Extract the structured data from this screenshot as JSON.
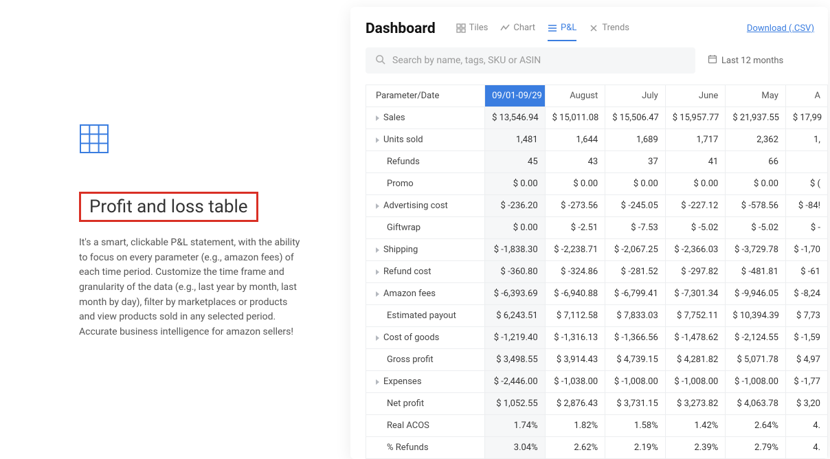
{
  "left": {
    "heading": "Profit and loss table",
    "description": "It's a smart, clickable P&L statement, with the ability to focus on every parameter (e.g., amazon fees) of each time period. Customize the time frame and granularity of the data (e.g., last year by month, last month by day), filter by marketplaces or products and view products sold in any selected period. Accurate business intelligence for amazon sellers!"
  },
  "dashboard": {
    "title": "Dashboard",
    "tabs": {
      "tiles": "Tiles",
      "chart": "Chart",
      "pl": "P&L",
      "trends": "Trends"
    },
    "download": "Download (.CSV)",
    "search_placeholder": "Search by name, tags, SKU or ASIN",
    "date_range": "Last 12 months",
    "param_header": "Parameter/Date",
    "columns": [
      "09/01-09/29",
      "August",
      "July",
      "June",
      "May",
      "A"
    ],
    "rows": [
      {
        "label": "Sales",
        "expandable": true,
        "values": [
          "$ 13,546.94",
          "$ 15,011.08",
          "$ 15,506.47",
          "$ 15,957.77",
          "$ 21,937.55",
          "$ 17,99"
        ]
      },
      {
        "label": "Units sold",
        "expandable": true,
        "values": [
          "1,481",
          "1,644",
          "1,689",
          "1,717",
          "2,362",
          "1,"
        ]
      },
      {
        "label": "Refunds",
        "expandable": false,
        "values": [
          "45",
          "43",
          "37",
          "41",
          "66",
          ""
        ]
      },
      {
        "label": "Promo",
        "expandable": false,
        "values": [
          "$ 0.00",
          "$ 0.00",
          "$ 0.00",
          "$ 0.00",
          "$ 0.00",
          "$ ("
        ]
      },
      {
        "label": "Advertising cost",
        "expandable": true,
        "values": [
          "$ -236.20",
          "$ -273.56",
          "$ -245.05",
          "$ -227.12",
          "$ -578.56",
          "$ -84!"
        ]
      },
      {
        "label": "Giftwrap",
        "expandable": false,
        "values": [
          "$ 0.00",
          "$ -2.51",
          "$ -7.53",
          "$ -5.02",
          "$ -5.02",
          "$ -"
        ]
      },
      {
        "label": "Shipping",
        "expandable": true,
        "values": [
          "$ -1,838.30",
          "$ -2,238.71",
          "$ -2,067.25",
          "$ -2,366.03",
          "$ -3,729.78",
          "$ -1,70"
        ]
      },
      {
        "label": "Refund cost",
        "expandable": true,
        "values": [
          "$ -360.80",
          "$ -324.86",
          "$ -281.52",
          "$ -297.82",
          "$ -481.81",
          "$ -61"
        ]
      },
      {
        "label": "Amazon fees",
        "expandable": true,
        "values": [
          "$ -6,393.69",
          "$ -6,940.88",
          "$ -6,799.41",
          "$ -7,301.34",
          "$ -9,946.05",
          "$ -8,24"
        ]
      },
      {
        "label": "Estimated payout",
        "expandable": false,
        "values": [
          "$ 6,243.51",
          "$ 7,112.58",
          "$ 7,833.03",
          "$ 7,752.11",
          "$ 10,394.39",
          "$ 7,73"
        ]
      },
      {
        "label": "Cost of goods",
        "expandable": true,
        "values": [
          "$ -1,219.40",
          "$ -1,316.13",
          "$ -1,366.56",
          "$ -1,478.62",
          "$ -2,124.55",
          "$ -1,59"
        ]
      },
      {
        "label": "Gross profit",
        "expandable": false,
        "values": [
          "$ 3,498.55",
          "$ 3,914.43",
          "$ 4,739.15",
          "$ 4,281.82",
          "$ 5,071.78",
          "$ 4,97"
        ]
      },
      {
        "label": "Expenses",
        "expandable": true,
        "values": [
          "$ -2,446.00",
          "$ -1,038.00",
          "$ -1,008.00",
          "$ -1,008.00",
          "$ -1,008.00",
          "$ -1,77"
        ]
      },
      {
        "label": "Net profit",
        "expandable": false,
        "values": [
          "$ 1,052.55",
          "$ 2,876.43",
          "$ 3,731.15",
          "$ 3,273.82",
          "$ 4,063.78",
          "$ 3,20"
        ]
      },
      {
        "label": "Real ACOS",
        "expandable": false,
        "values": [
          "1.74%",
          "1.82%",
          "1.58%",
          "1.42%",
          "2.64%",
          "4."
        ]
      },
      {
        "label": "% Refunds",
        "expandable": false,
        "values": [
          "3.04%",
          "2.62%",
          "2.19%",
          "2.39%",
          "2.79%",
          "4."
        ]
      }
    ]
  }
}
